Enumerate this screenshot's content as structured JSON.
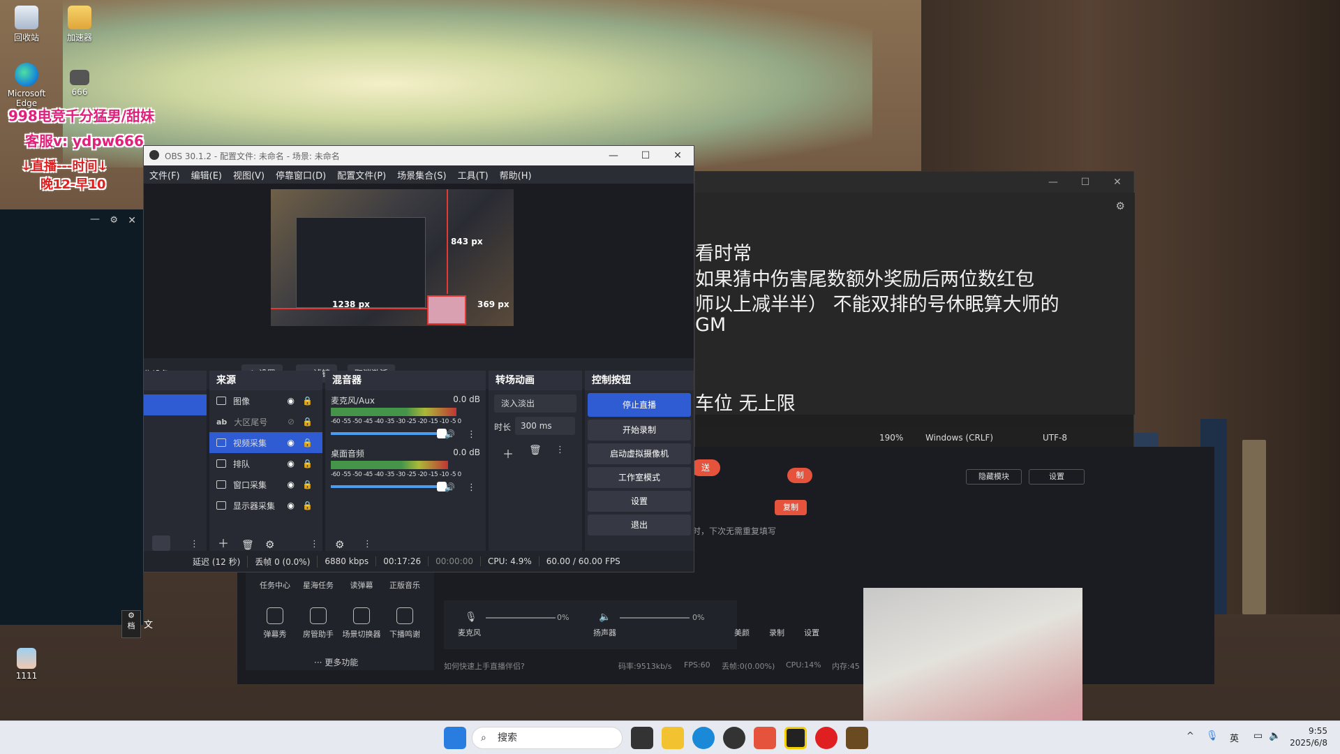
{
  "desktop": {
    "icons": [
      {
        "label": "回收站"
      },
      {
        "label": "加速器"
      },
      {
        "label": "Microsoft Edge"
      },
      {
        "label": "666"
      },
      {
        "label": "1111"
      }
    ],
    "overlay_text": {
      "line1": "998电竞千分猛男/甜妹",
      "line2": "客服v: ydpw666",
      "line3": "↓直播---时间↓",
      "line4": "晚12-早10"
    },
    "side_labels": {
      "settings_label": "档",
      "settings_side": "文"
    }
  },
  "obs": {
    "title": "OBS 30.1.2 - 配置文件: 未命名 - 场景: 未命名",
    "menu": [
      "文件(F)",
      "编辑(E)",
      "视图(V)",
      "停靠窗口(D)",
      "配置文件(P)",
      "场景集合(S)",
      "工具(T)",
      "帮助(H)"
    ],
    "preview_labels": {
      "width_px": "1238 px",
      "top_px": "843 px",
      "right_px": "369 px"
    },
    "toolbar": {
      "device_label": "集设备",
      "settings": "设置",
      "filters": "滤镜",
      "deactivate": "取消激活"
    },
    "sources": {
      "header": "来源",
      "items": [
        {
          "name": "图像",
          "icon": "image-icon"
        },
        {
          "name": "大区尾号",
          "icon": "text-icon"
        },
        {
          "name": "视频采集",
          "icon": "camera-icon"
        },
        {
          "name": "排队",
          "icon": "window-icon"
        },
        {
          "name": "窗口采集",
          "icon": "window-icon"
        },
        {
          "name": "显示器采集",
          "icon": "monitor-icon"
        }
      ]
    },
    "mixer": {
      "header": "混音器",
      "channels": [
        {
          "name": "麦克风/Aux",
          "db": "0.0 dB",
          "level": 0.85
        },
        {
          "name": "桌面音频",
          "db": "0.0 dB",
          "level": 0.8
        }
      ],
      "ticks": "-60 -55 -50 -45 -40 -35 -30 -25 -20 -15 -10 -5 0"
    },
    "transitions": {
      "header": "转场动画",
      "type": "淡入淡出",
      "duration_label": "时长",
      "duration": "300 ms"
    },
    "controls": {
      "header": "控制按钮",
      "stop_stream": "停止直播",
      "start_record": "开始录制",
      "virtual_cam": "启动虚拟摄像机",
      "studio_mode": "工作室模式",
      "settings": "设置",
      "exit": "退出"
    },
    "status": {
      "delay": "延迟 (12 秒)",
      "dropped": "丢帧 0 (0.0%)",
      "bitrate": "6880 kbps",
      "stream_time": "00:17:26",
      "record_time": "00:00:00",
      "cpu": "CPU: 4.9%",
      "fps": "60.00 / 60.00 FPS"
    }
  },
  "notepad": {
    "lines": [
      "看时常",
      "如果猜中伤害尾数额外奖励后两位数红包",
      "师以上减半半）   不能双排的号休眠算大师的",
      "GM",
      "车位  无上限"
    ],
    "status": {
      "zoom": "190%",
      "line_ending": "Windows (CRLF)",
      "encoding": "UTF-8"
    }
  },
  "companion": {
    "buttons": {
      "send": "送",
      "copy1": "制",
      "copy2": "复制",
      "hide_module": "隐藏模块",
      "settings": "设置"
    },
    "hint": "时，下次无需重复填写",
    "tools_row1": [
      "任务中心",
      "星海任务",
      "读弹幕",
      "正版音乐"
    ],
    "tools_row2": [
      "弹幕秀",
      "房管助手",
      "场景切换器",
      "下播鸣谢"
    ],
    "more": "··· 更多功能",
    "mic_label": "麦克风",
    "mic_pct": "0%",
    "speaker_label": "扬声器",
    "speaker_pct": "0%",
    "right_tools": [
      "美颜",
      "录制",
      "设置"
    ],
    "help": "如何快速上手直播伴侣?",
    "stats": {
      "bitrate": "码率:9513kb/s",
      "fps": "FPS:60",
      "drop": "丢帧:0(0.00%)",
      "cpu": "CPU:14%",
      "mem": "内存:45"
    }
  },
  "taskbar": {
    "search": "搜索",
    "ime": "英",
    "time": "9:55",
    "date": "2025/6/8"
  },
  "colors": {
    "obs_accent": "#2f5bd3",
    "red": "#e53935",
    "notepad_bg": "#272727"
  }
}
